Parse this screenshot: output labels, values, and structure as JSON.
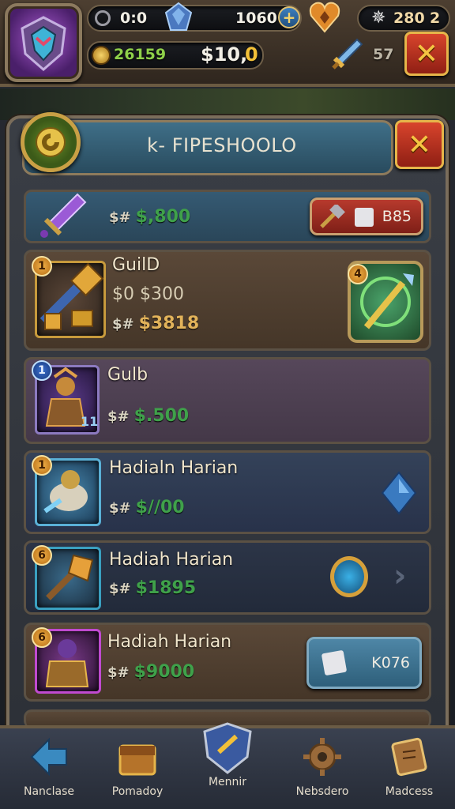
{
  "hud": {
    "level_value": "0:0",
    "gems_value": "1060",
    "trophy_value": "280",
    "trophy_suffix": "2",
    "gold_value": "26159",
    "cash_value": "$10,",
    "cash_suffix": "0",
    "sword_count": "57"
  },
  "shop": {
    "title": "k- FIPESHOOLO",
    "featured": {
      "price_prefix": "$#",
      "price": "$,800",
      "button_label": "B85"
    },
    "items": [
      {
        "badge": "1",
        "name": "GuilD",
        "line2": "$0 $300",
        "price_prefix": "$#",
        "price": "$3818",
        "right_badge": "4"
      },
      {
        "badge": "1",
        "name": "Gulb",
        "price_prefix": "$#",
        "price": "$.500",
        "thumb_num": "11"
      },
      {
        "badge": "1",
        "name": "Hadialn Harian",
        "price_prefix": "$#",
        "price": "$//00"
      },
      {
        "badge": "6",
        "name": "Hadiah Harian",
        "price_prefix": "$#",
        "price": "$1895"
      },
      {
        "badge": "6",
        "name": "Hadiah Harian",
        "price_prefix": "$#",
        "price": "$9000",
        "button_label": "K076"
      }
    ]
  },
  "nav": {
    "items": [
      {
        "label": "Nanclase",
        "icon": "arrow-icon"
      },
      {
        "label": "Pomadoy",
        "icon": "treasure-chest-icon"
      },
      {
        "label": "Mennir",
        "icon": "shield-icon"
      },
      {
        "label": "Nebsdero",
        "icon": "gear-icon"
      },
      {
        "label": "Madcess",
        "icon": "scroll-icon"
      }
    ]
  },
  "colors": {
    "accent_gold": "#e6b54a",
    "price_green": "#3fa14a",
    "close_red": "#c43a28"
  }
}
